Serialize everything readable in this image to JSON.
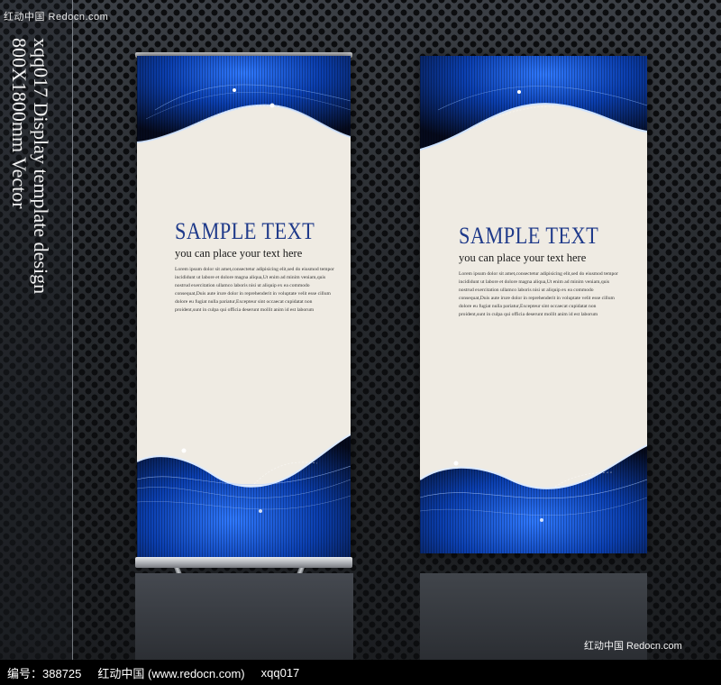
{
  "watermark": {
    "top_left": "红动中国 Redocn.com",
    "bottom_right": "红动中国 Redocn.com"
  },
  "vertical_text": {
    "line1": "xqq017 Display template design",
    "line2": "800X1800mm Vector"
  },
  "banners": [
    {
      "title": "SAMPLE TEXT",
      "subtitle": "you can place your text here",
      "body": [
        "Lorem ipsum dolor sit amet,consectetur adipisicing elit,sed do eiusmod tempor",
        "incididunt ut labore et dolore magna aliqua,Ut enim ad minim veniam,quis",
        "nostrud exercitation ullamco laboris nisi ut aliquip ex ea commodo",
        "consequat,Duis aute irure dolor in reprehenderit in voluptate velit esse cillum",
        "dolore eu fugiat nulla pariatur,Excepteur sint occaecat cupidatat non",
        "proident,sunt in culpa qui officia deserunt mollit anim id est laborum"
      ]
    },
    {
      "title": "SAMPLE TEXT",
      "subtitle": "you can place your text here",
      "body": [
        "Lorem ipsum dolor sit amet,consectetur adipisicing elit,sed do eiusmod tempor",
        "incididunt ut labore et dolore magna aliqua,Ut enim ad minim veniam,quis",
        "nostrud exercitation ullamco laboris nisi ut aliquip ex ea commodo",
        "consequat,Duis aute irure dolor in reprehenderit in voluptate velit esse cillum",
        "dolore eu fugiat nulla pariatur,Excepteur sint occaecat cupidatat non",
        "proident,sunt in culpa qui officia deserunt mollit anim id est laborum"
      ]
    }
  ],
  "footer": {
    "id_label": "编号：388725",
    "site": "红动中国 (www.redocn.com)",
    "code": "xqq017"
  },
  "colors": {
    "title_blue": "#1f3a8a",
    "wave_blue": "#1e5bd6",
    "banner_cream": "#efebe3"
  }
}
